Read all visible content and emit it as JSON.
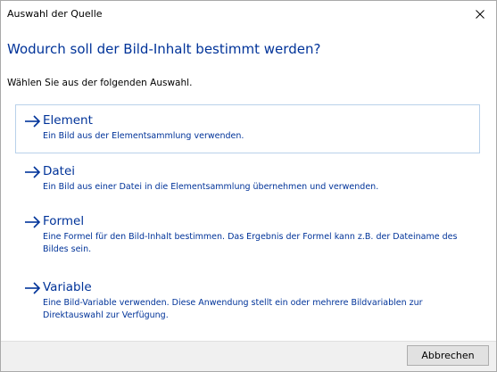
{
  "window": {
    "title": "Auswahl der Quelle",
    "close_icon": "close-icon"
  },
  "main_instruction": "Wodurch soll der Bild-Inhalt bestimmt werden?",
  "content": "Wählen Sie aus der folgenden Auswahl.",
  "options": [
    {
      "icon": "arrow-right-icon",
      "title": "Element",
      "description": "Ein Bild aus der Elementsammlung verwenden.",
      "focused": true
    },
    {
      "icon": "arrow-right-icon",
      "title": "Datei",
      "description": "Ein Bild aus einer Datei in die Elementsammlung übernehmen und verwenden.",
      "focused": false
    },
    {
      "icon": "arrow-right-icon",
      "title": "Formel",
      "description": "Eine Formel für den Bild-Inhalt bestimmen. Das Ergebnis der Formel kann z.B. der Dateiname des Bildes sein.",
      "focused": false
    },
    {
      "icon": "arrow-right-icon",
      "title": "Variable",
      "description": "Eine Bild-Variable verwenden. Diese Anwendung stellt ein oder mehrere Bildvariablen zur Direktauswahl zur Verfügung.",
      "focused": false
    }
  ],
  "footer": {
    "cancel_label": "Abbrechen"
  },
  "colors": {
    "instruction": "#003399",
    "link": "#003399",
    "footer_bg": "#f0f0f0",
    "focus_border": "#b9d1ea"
  }
}
